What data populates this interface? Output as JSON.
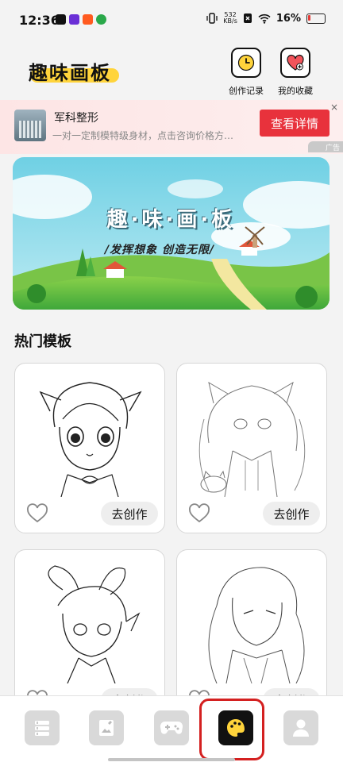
{
  "status_bar": {
    "time": "12:36",
    "net_speed_value": "532",
    "net_speed_unit": "KB/s",
    "battery": "16%"
  },
  "header": {
    "logo_text": "趣味画板",
    "history_label": "创作记录",
    "favorites_label": "我的收藏"
  },
  "ad": {
    "title": "军科整形",
    "description": "一对一定制模特级身材，点击咨询价格方…",
    "button_label": "查看详情",
    "close": "×",
    "tag": "广告"
  },
  "banner": {
    "title": "趣·味·画·板",
    "subtitle": "/发挥想象  创造无限/"
  },
  "section": {
    "title": "热门模板"
  },
  "templates": [
    {
      "action_label": "去创作"
    },
    {
      "action_label": "去创作"
    },
    {
      "action_label": "去创作"
    },
    {
      "action_label": "去创作"
    }
  ],
  "bottom_nav": [
    {
      "icon": "book-stack-icon",
      "active": false
    },
    {
      "icon": "image-edit-icon",
      "active": false
    },
    {
      "icon": "gamepad-icon",
      "active": false
    },
    {
      "icon": "palette-icon",
      "active": true
    },
    {
      "icon": "user-icon",
      "active": false
    }
  ],
  "colors": {
    "accent_yellow": "#ffd43b",
    "ad_button": "#e8323c",
    "highlight": "#d42020"
  }
}
